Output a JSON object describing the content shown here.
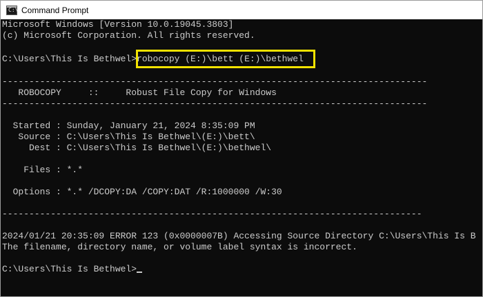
{
  "window": {
    "title": "Command Prompt",
    "icon": "cmd-icon"
  },
  "console": {
    "text_color": "#cccccc",
    "background": "#0c0c0c",
    "highlight_color": "#f2e200",
    "lines": {
      "l01": "Microsoft Windows [Version 10.0.19045.3803]",
      "l02": "(c) Microsoft Corporation. All rights reserved.",
      "l03_prompt": "C:\\Users\\This Is Bethwel>",
      "l03_command": "robocopy (E:)\\bett (E:)\\bethwel",
      "l04": "-------------------------------------------------------------------------------",
      "l05": "   ROBOCOPY     ::     Robust File Copy for Windows",
      "l06": "-------------------------------------------------------------------------------",
      "l07": "  Started : Sunday, January 21, 2024 8:35:09 PM",
      "l08": "   Source : C:\\Users\\This Is Bethwel\\(E:)\\bett\\",
      "l09": "     Dest : C:\\Users\\This Is Bethwel\\(E:)\\bethwel\\",
      "l10": "    Files : *.*",
      "l11": "  Options : *.* /DCOPY:DA /COPY:DAT /R:1000000 /W:30",
      "l12": "------------------------------------------------------------------------------",
      "l13": "2024/01/21 20:35:09 ERROR 123 (0x0000007B) Accessing Source Directory C:\\Users\\This Is B",
      "l14": "The filename, directory name, or volume label syntax is incorrect.",
      "l15_prompt": "C:\\Users\\This Is Bethwel>"
    }
  }
}
